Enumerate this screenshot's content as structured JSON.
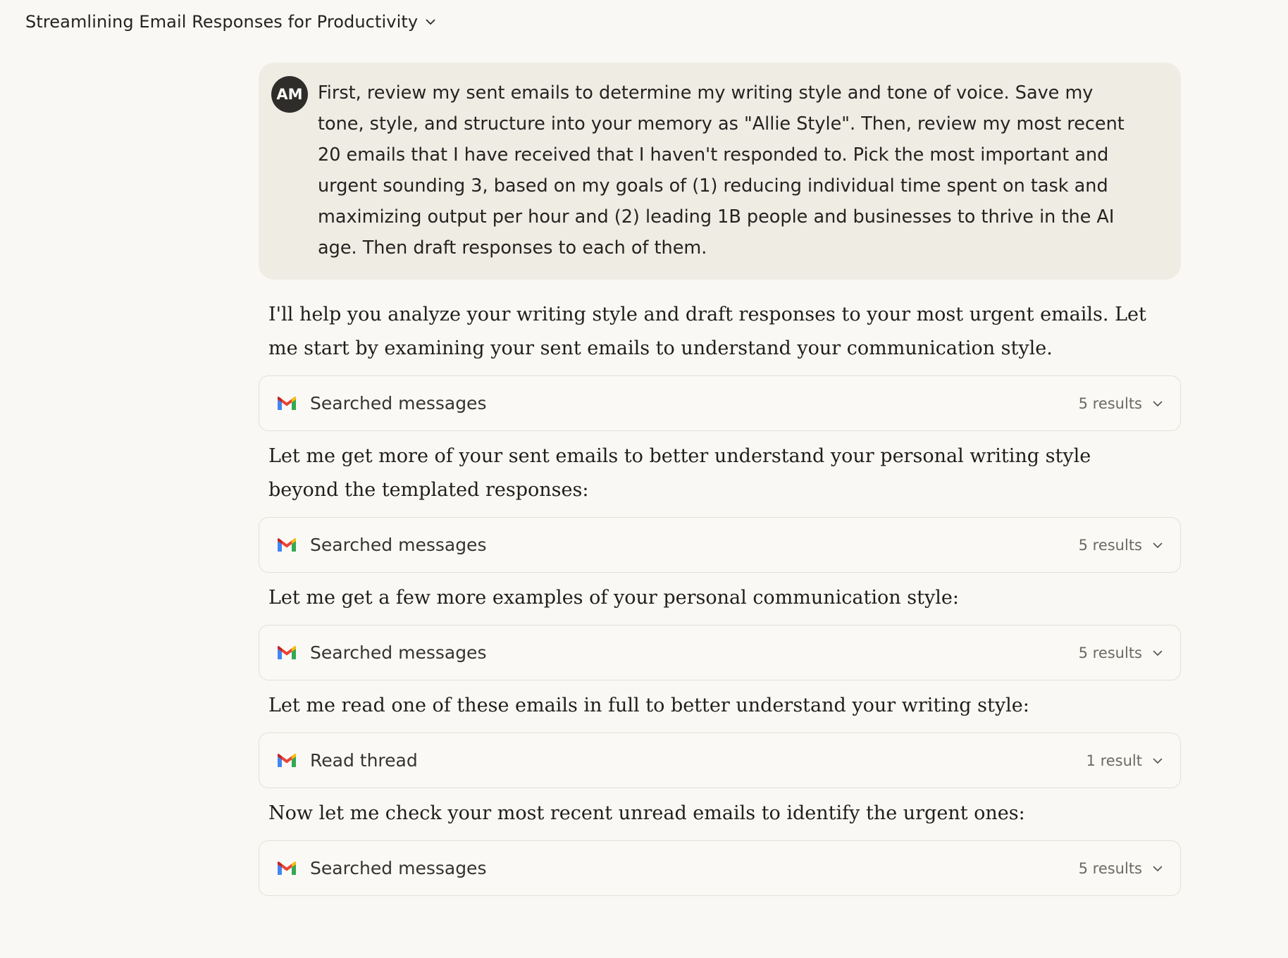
{
  "header": {
    "title": "Streamlining Email Responses for Productivity"
  },
  "user_message": {
    "avatar_initials": "AM",
    "text": "First, review my sent emails to determine my writing style and tone of voice. Save my tone, style, and structure into your memory as \"Allie Style\". Then, review my most recent 20 emails that I have received that I haven't responded to. Pick the most important and urgent sounding 3, based on my goals of (1) reducing individual time spent on task and maximizing output per hour and (2) leading 1B people and businesses to thrive in the AI age. Then draft responses to each of them."
  },
  "assistant": {
    "intro": "I'll help you analyze your writing style and draft responses to your most urgent emails. Let me start by examining your sent emails to understand your communication style.",
    "step2": "Let me get more of your sent emails to better understand your personal writing style beyond the templated responses:",
    "step3": "Let me get a few more examples of your personal communication style:",
    "step4": "Let me read one of these emails in full to better understand your writing style:",
    "step5": "Now let me check your most recent unread emails to identify the urgent ones:"
  },
  "tools": [
    {
      "label": "Searched messages",
      "count": "5 results",
      "icon": "gmail-icon"
    },
    {
      "label": "Searched messages",
      "count": "5 results",
      "icon": "gmail-icon"
    },
    {
      "label": "Searched messages",
      "count": "5 results",
      "icon": "gmail-icon"
    },
    {
      "label": "Read thread",
      "count": "1 result",
      "icon": "gmail-icon"
    },
    {
      "label": "Searched messages",
      "count": "5 results",
      "icon": "gmail-icon"
    }
  ],
  "colors": {
    "background": "#f9f8f4",
    "user_bubble": "#efece4",
    "avatar": "#2e2d2a",
    "gmail_red": "#ea4335",
    "gmail_blue": "#4285f4",
    "gmail_green": "#34a853",
    "gmail_yellow": "#fbbc04"
  }
}
